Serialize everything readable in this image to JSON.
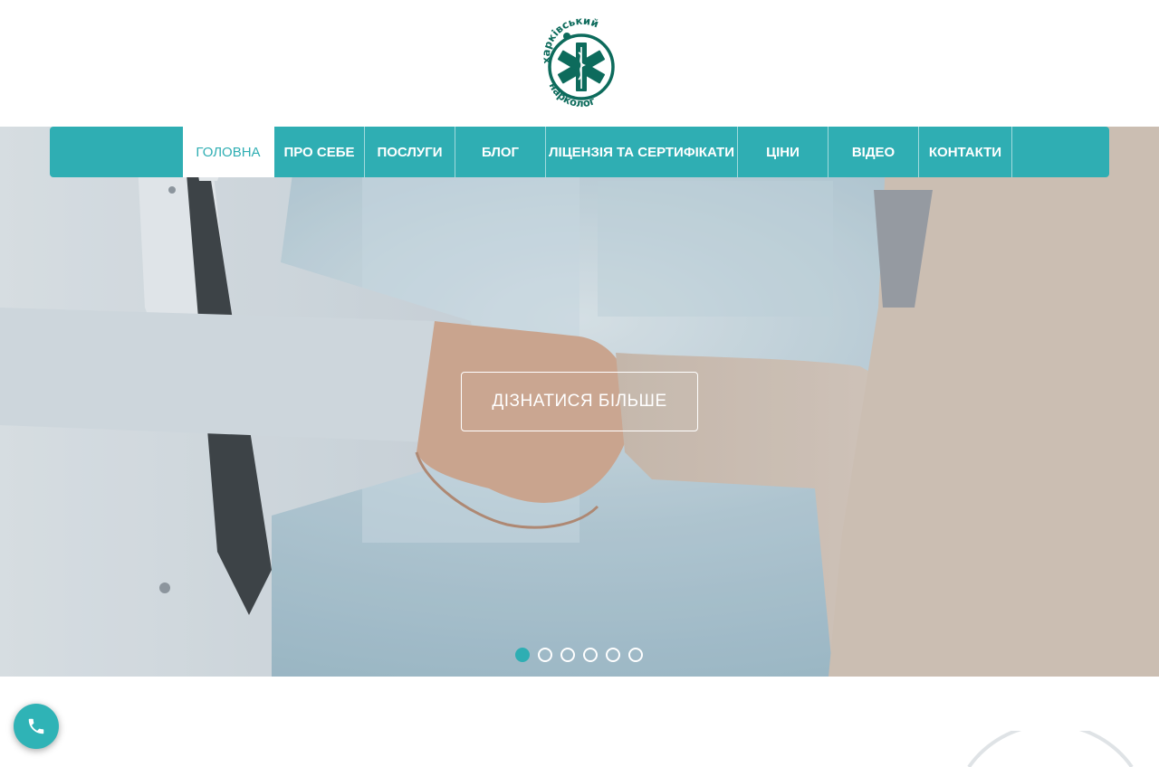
{
  "logo": {
    "text_top": "харківський",
    "text_bottom": "нарколог",
    "icon": "star-of-life-icon",
    "color": "#0d6b5c"
  },
  "nav": {
    "items": [
      {
        "label": "ГОЛОВНА",
        "active": true
      },
      {
        "label": "ПРО СЕБЕ",
        "active": false
      },
      {
        "label": "ПОСЛУГИ",
        "active": false
      },
      {
        "label": "БЛОГ",
        "active": false
      },
      {
        "label": "ЛІЦЕНЗІЯ ТА СЕРТИФІКАТИ",
        "active": false
      },
      {
        "label": "ЦІНИ",
        "active": false
      },
      {
        "label": "ВІДЕО",
        "active": false
      },
      {
        "label": "КОНТАКТИ",
        "active": false
      }
    ]
  },
  "hero": {
    "cta_label": "ДІЗНАТИСЯ БІЛЬШЕ",
    "slides_count": 6,
    "active_slide": 1
  },
  "call_button": {
    "icon": "phone-icon"
  },
  "colors": {
    "accent": "#2faeb3",
    "logo_green": "#0d6b5c"
  }
}
